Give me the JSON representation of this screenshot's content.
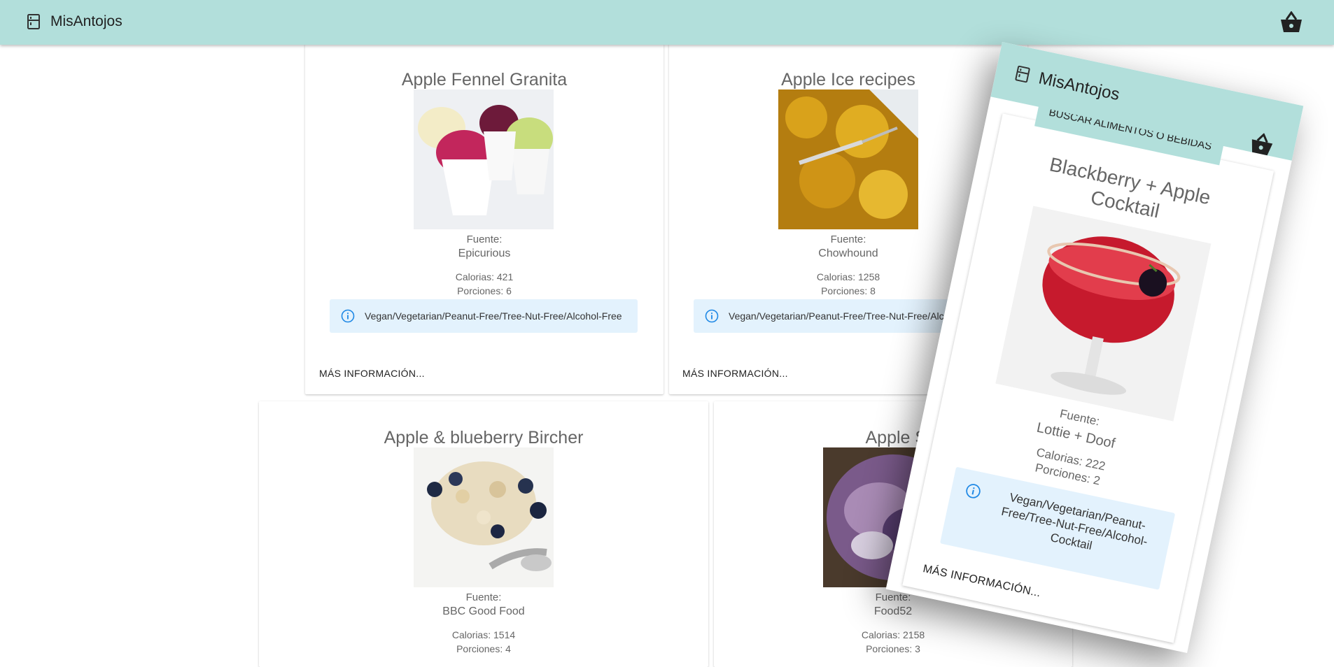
{
  "app": {
    "title": "MisAntojos"
  },
  "colors": {
    "appbar": "#b2dfdb",
    "chip": "#e3f2fd",
    "info": "#1e88e5"
  },
  "icons": {
    "logo": "kitchen-icon",
    "cart": "shopping-basket-icon",
    "info": "info-outline-icon"
  },
  "labels": {
    "source": "Fuente:",
    "more": "MÁS INFORMACIÓN..."
  },
  "recipes": [
    {
      "title": "Apple Fennel Granita",
      "source": "Epicurious",
      "calories": "Calorias: 421",
      "portions": "Porciones: 6",
      "tags": "Vegan/Vegetarian/Peanut-Free/Tree-Nut-Free/Alcohol-Free"
    },
    {
      "title": "Apple Ice recipes",
      "source": "Chowhound",
      "calories": "Calorias: 1258",
      "portions": "Porciones: 8",
      "tags": "Vegan/Vegetarian/Peanut-Free/Tree-Nut-Free/Alcohol-Free"
    },
    {
      "title": "Apple & blueberry Bircher",
      "source": "BBC Good Food",
      "calories": "Calorias: 1514",
      "portions": "Porciones: 4"
    },
    {
      "title": "Apple Sla",
      "source": "Food52",
      "calories": "Calorias: 2158",
      "portions": "Porciones: 3"
    }
  ],
  "mobile": {
    "title": "MisAntojos",
    "search_button": "BUSCAR ALIMENTOS O BEBIDAS",
    "recipe": {
      "title": "Blackberry + Apple Cocktail",
      "source": "Lottie + Doof",
      "calories": "Calorias: 222",
      "portions": "Porciones: 2",
      "tags": "Vegan/Vegetarian/Peanut-Free/Tree-Nut-Free/Alcohol-Cocktail"
    }
  }
}
